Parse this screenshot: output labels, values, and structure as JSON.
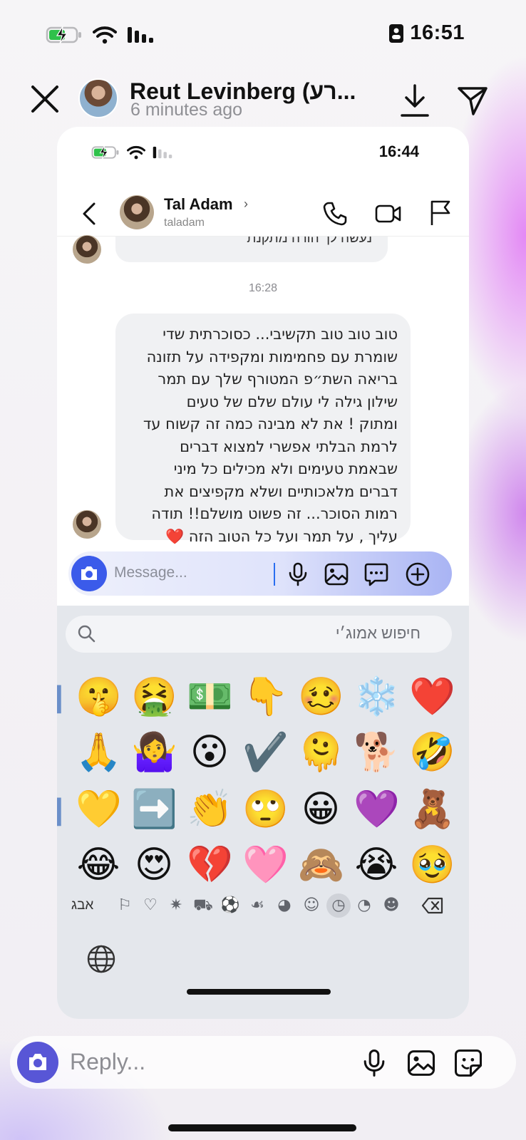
{
  "status_bar": {
    "time": "16:51"
  },
  "story": {
    "sender_name": "Reut Levinberg (רע...",
    "posted_ago": "6 minutes ago"
  },
  "inner": {
    "status_time": "16:44",
    "chat": {
      "name": "Tal Adam",
      "username": "taladam",
      "prev_message_fragment": "נעשה לך הורה מתקנת",
      "timestamp": "16:28",
      "message_lines": [
        "טוב טוב טוב תקשיבי... כסוכרתית שדי",
        "שומרת עם פחמימות ומקפידה על תזונה",
        "בריאה השת״פ המטורף שלך עם תמר",
        "שילון גילה לי עולם שלם של טעים",
        "ומתוק ! את לא מבינה כמה זה קשוח עד",
        "לרמת הבלתי אפשרי למצוא דברים",
        "שבאמת טעימים ולא מכילים כל מיני",
        "דברים מלאכותיים ושלא מקפיצים את",
        "רמות הסוכר... זה פשוט מושלם!! תודה",
        "עליך , על תמר ועל כל הטוב הזה"
      ],
      "message_end_emoji": "❤️",
      "composer_placeholder": "Message..."
    },
    "keyboard": {
      "search_placeholder": "חיפוש אמוג׳י",
      "emoji_rows": [
        [
          "🤫",
          "🤮",
          "💵",
          "👇",
          "🥴",
          "❄️",
          "❤️"
        ],
        [
          "🙏",
          "🤷‍♀️",
          "😮",
          "✔️",
          "🫠",
          "🐕",
          "🤣"
        ],
        [
          "💛",
          "➡️",
          "👏",
          "🙄",
          "😀",
          "💜",
          "🧸"
        ],
        [
          "😂",
          "😍",
          "💔",
          "🩷",
          "🙈",
          "😭",
          "🥹"
        ]
      ],
      "abc_label": "אבג",
      "categories": [
        "flag",
        "heart",
        "bulb",
        "car",
        "ball",
        "apple",
        "dog",
        "smile",
        "clock",
        "sticker",
        "face"
      ],
      "active_category": "clock"
    }
  },
  "reply": {
    "placeholder": "Reply..."
  }
}
